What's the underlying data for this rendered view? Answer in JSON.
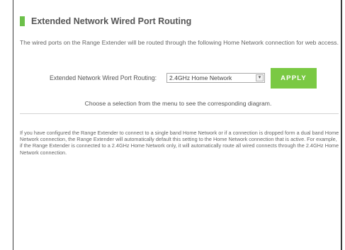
{
  "panel": {
    "title": "Extended Network Wired Port Routing",
    "description": "The wired ports on the Range Extender will be routed through the following Home Network connection for web access.",
    "routing": {
      "label": "Extended Network Wired Port Routing:",
      "selected_value": "2.4GHz Home Network",
      "arrow_glyph": "▾"
    },
    "apply_label": "APPLY",
    "hint": "Choose a selection from the menu to see the corresponding diagram.",
    "info": "If you have configured the Range Extender to connect to a single band Home Network or if a connection is dropped form a dual band Home Network connection, the Range Extender will automatically default this setting to the Home Network connection that is active. For example, if the Range Extender is connected to a 2.4GHz Home Network only, it will automatically route all wired connects through the 2.4GHz Home Network connection."
  },
  "colors": {
    "accent_green": "#7ac943",
    "title_marker": "#6cc04a"
  }
}
